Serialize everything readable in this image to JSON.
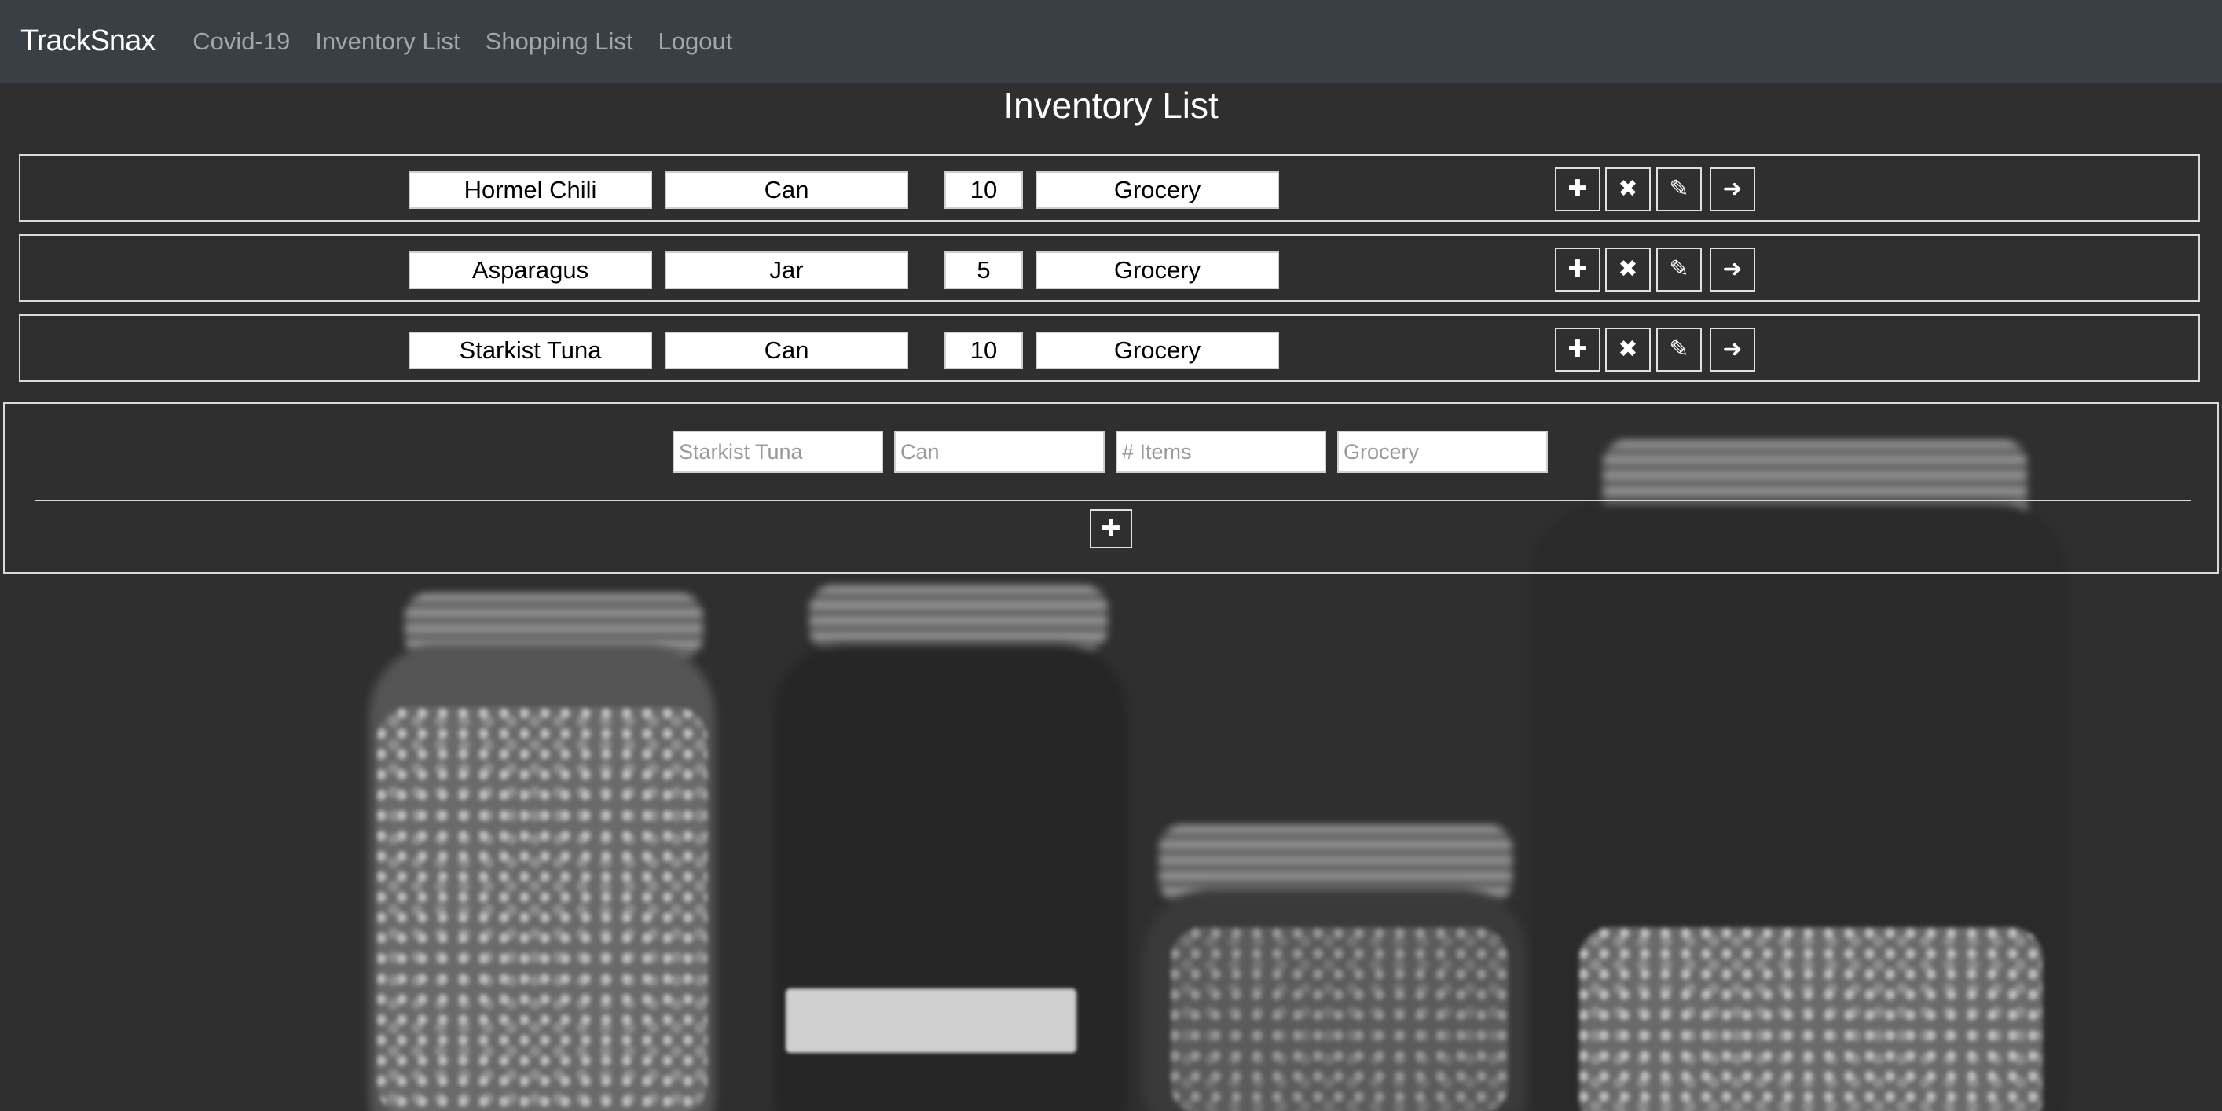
{
  "navbar": {
    "brand": "TrackSnax",
    "links": [
      "Covid-19",
      "Inventory List",
      "Shopping List",
      "Logout"
    ]
  },
  "page": {
    "title": "Inventory List"
  },
  "inventory": [
    {
      "name": "Hormel Chili",
      "type": "Can",
      "qty": "10",
      "category": "Grocery"
    },
    {
      "name": "Asparagus",
      "type": "Jar",
      "qty": "5",
      "category": "Grocery"
    },
    {
      "name": "Starkist Tuna",
      "type": "Can",
      "qty": "10",
      "category": "Grocery"
    }
  ],
  "actions": {
    "add_icon": "plus-icon",
    "delete_icon": "close-icon",
    "edit_icon": "edit-icon",
    "move_icon": "arrow-right-icon"
  },
  "new_item": {
    "name_placeholder": "Starkist Tuna",
    "type_placeholder": "Can",
    "qty_placeholder": "# Items",
    "category_placeholder": "Grocery"
  },
  "background": {
    "bar_color": "#3a3f46",
    "page_color": "#2f2f2f"
  }
}
